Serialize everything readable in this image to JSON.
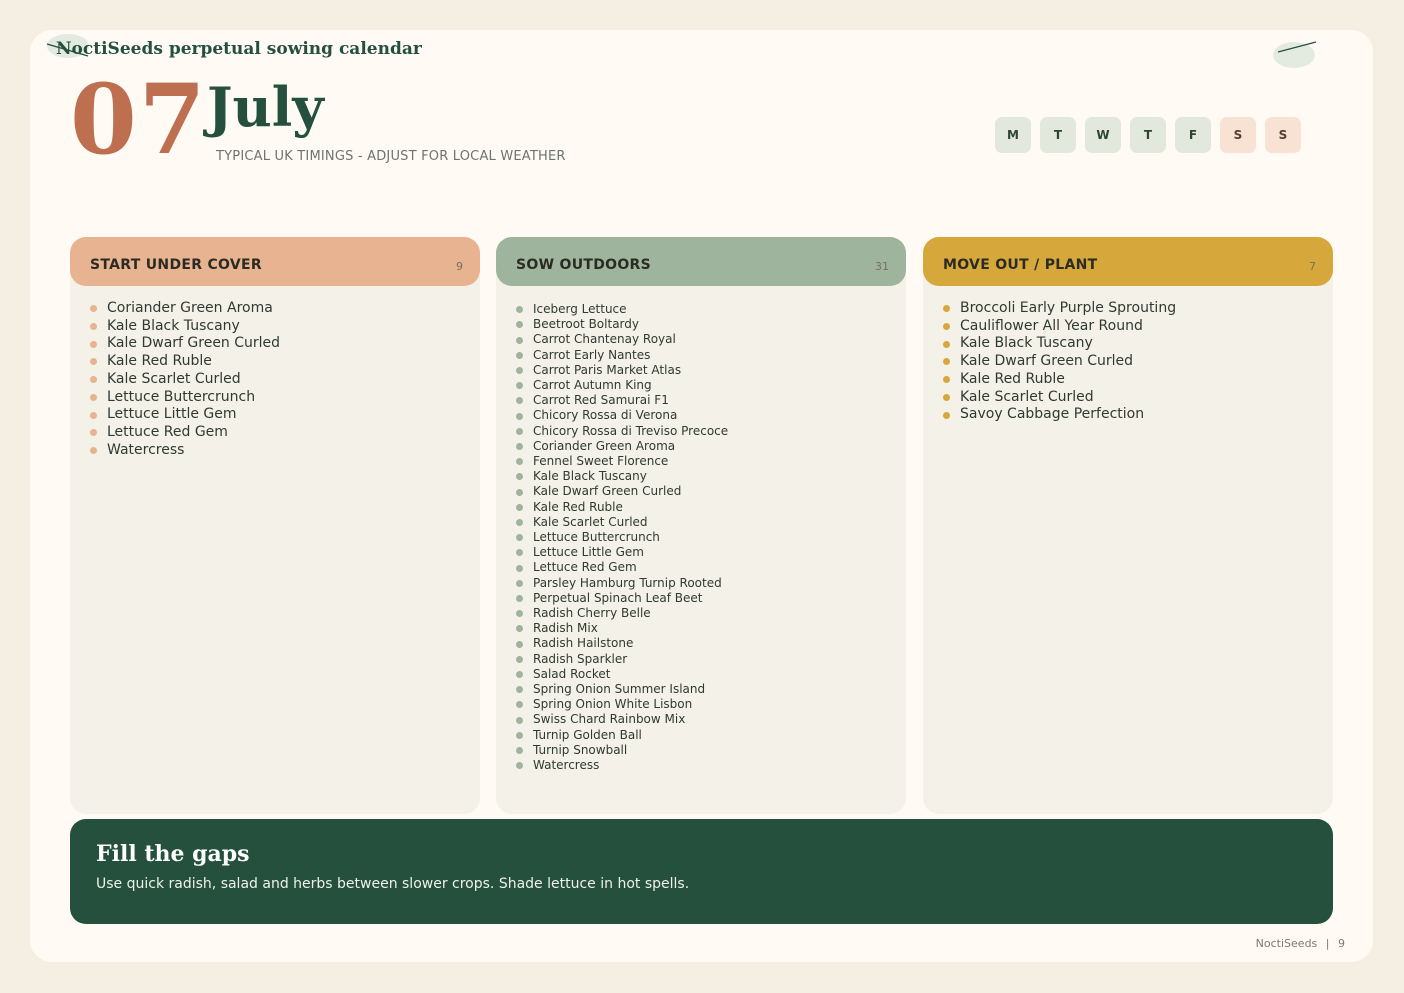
{
  "header": {
    "brand_title": "NoctiSeeds perpetual sowing calendar",
    "month_number": "07",
    "month_name": "July",
    "subtitle": "TYPICAL UK TIMINGS - ADJUST FOR LOCAL WEATHER"
  },
  "weekdays": [
    "M",
    "T",
    "W",
    "T",
    "F",
    "S",
    "S"
  ],
  "columns": {
    "under_cover": {
      "title": "START UNDER COVER",
      "count": "9",
      "color": "#e8b391",
      "items": [
        "Coriander Green Aroma",
        "Kale Black Tuscany",
        "Kale Dwarf Green Curled",
        "Kale Red Ruble",
        "Kale Scarlet Curled",
        "Lettuce Buttercrunch",
        "Lettuce Little Gem",
        "Lettuce Red Gem",
        "Watercress"
      ]
    },
    "outdoors": {
      "title": "SOW OUTDOORS",
      "count": "31",
      "color": "#9eb49c",
      "items": [
        "Iceberg Lettuce",
        "Beetroot Boltardy",
        "Carrot Chantenay Royal",
        "Carrot Early Nantes",
        "Carrot Paris Market Atlas",
        "Carrot Autumn King",
        "Carrot Red Samurai F1",
        "Chicory Rossa di Verona",
        "Chicory Rossa di Treviso Precoce",
        "Coriander Green Aroma",
        "Fennel Sweet Florence",
        "Kale Black Tuscany",
        "Kale Dwarf Green Curled",
        "Kale Red Ruble",
        "Kale Scarlet Curled",
        "Lettuce Buttercrunch",
        "Lettuce Little Gem",
        "Lettuce Red Gem",
        "Parsley Hamburg Turnip Rooted",
        "Perpetual Spinach Leaf Beet",
        "Radish Cherry Belle",
        "Radish Mix",
        "Radish Hailstone",
        "Radish Sparkler",
        "Salad Rocket",
        "Spring Onion Summer Island",
        "Spring Onion White Lisbon",
        "Swiss Chard Rainbow Mix",
        "Turnip Golden Ball",
        "Turnip Snowball",
        "Watercress"
      ]
    },
    "move_out": {
      "title": "MOVE OUT / PLANT",
      "count": "7",
      "color": "#d6a83c",
      "items": [
        "Broccoli Early Purple Sprouting",
        "Cauliflower All Year Round",
        "Kale Black Tuscany",
        "Kale Dwarf Green Curled",
        "Kale Red Ruble",
        "Kale Scarlet Curled",
        "Savoy Cabbage Perfection"
      ]
    }
  },
  "tip": {
    "title": "Fill the gaps",
    "text": "Use quick radish, salad and herbs between slower crops. Shade lettuce in hot spells."
  },
  "footer": {
    "brand": "NoctiSeeds",
    "separator": "|",
    "page": "9"
  },
  "colors": {
    "accent_green": "#24503d",
    "accent_terracotta": "#bd6f4f",
    "weekday_bg": "#e2e8dc",
    "weekend_bg": "#f7e2d3"
  }
}
